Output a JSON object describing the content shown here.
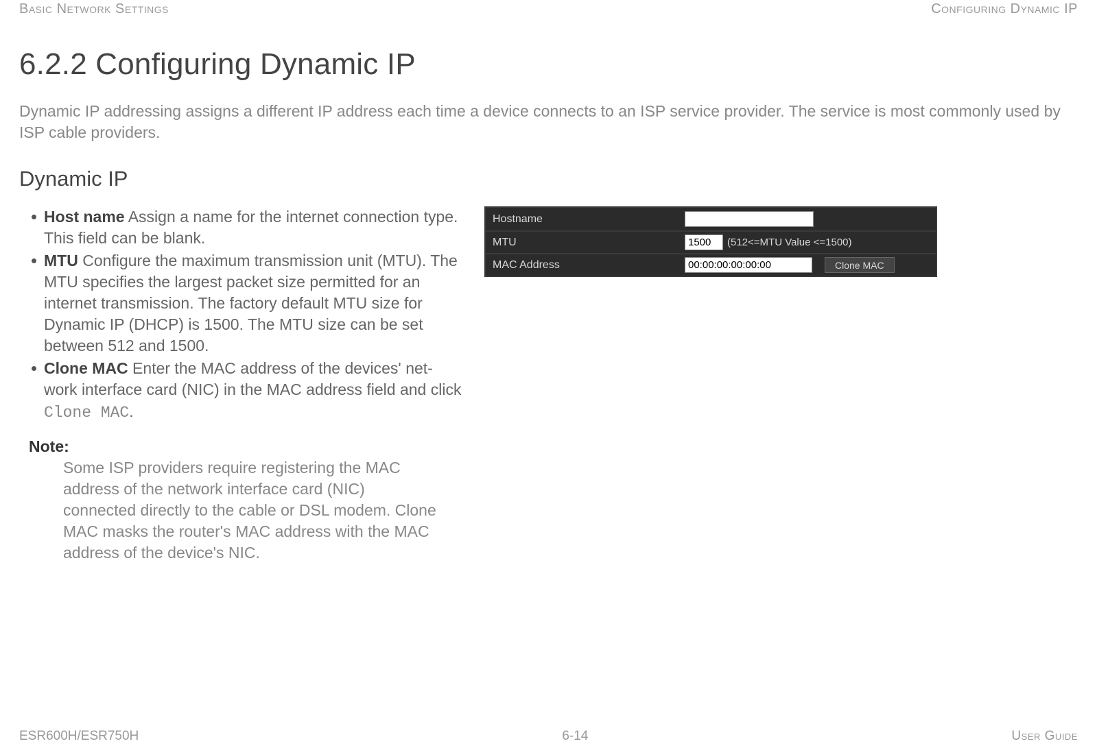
{
  "header": {
    "left": "Basic Network Settings",
    "right": "Configuring Dynamic IP"
  },
  "title": "6.2.2 Configuring Dynamic IP",
  "intro": "Dynamic IP addressing assigns a different IP address each time a device connects to an ISP service provider. The service is most commonly used by ISP cable providers.",
  "subhead": "Dynamic IP",
  "fields": {
    "hostname": {
      "label": "Host name",
      "desc": "  Assign a name for the internet connection type. This field can be blank."
    },
    "mtu": {
      "label": "MTU",
      "desc": "  Configure the maximum transmission unit (MTU). The MTU specifies the largest packet size permitted for an internet transmission. The factory default MTU size for Dynamic IP (DHCP) is 1500. The MTU size can be set between 512 and 1500."
    },
    "clonemac": {
      "label": "Clone MAC",
      "desc_pre": "  Enter the MAC address of the devices' net-work interface card (NIC) in the MAC address field and click ",
      "code": "Clone MAC",
      "desc_post": "."
    }
  },
  "note": {
    "label": "Note:",
    "body": "Some ISP providers require registering the MAC address of the network interface card (NIC) connected directly to the cable or DSL modem. Clone MAC masks the router's MAC address with the MAC address of the device's NIC."
  },
  "panel": {
    "hostname": {
      "label": "Hostname",
      "value": ""
    },
    "mtu": {
      "label": "MTU",
      "value": "1500",
      "hint": "(512<=MTU Value <=1500)"
    },
    "mac": {
      "label": "MAC Address",
      "value": "00:00:00:00:00:00",
      "button": "Clone MAC"
    }
  },
  "footer": {
    "left": "ESR600H/ESR750H",
    "center": "6-14",
    "right": "User Guide"
  }
}
